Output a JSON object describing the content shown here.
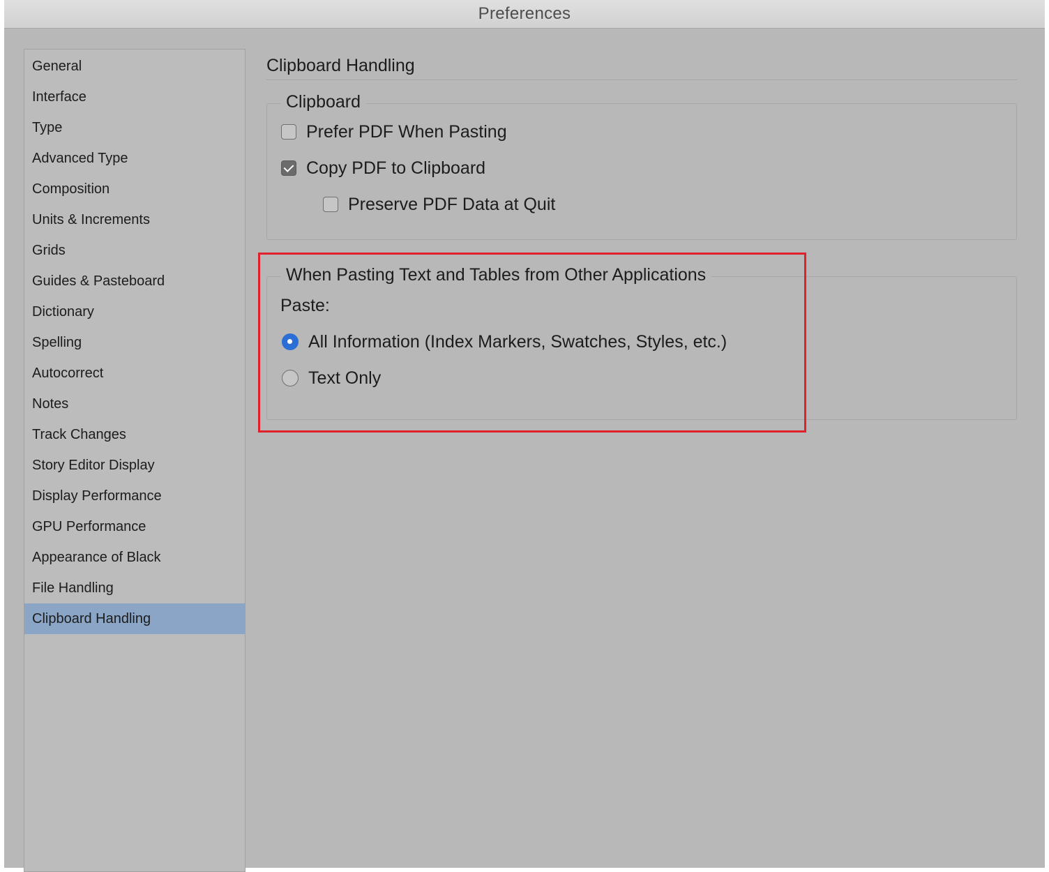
{
  "window": {
    "title": "Preferences"
  },
  "sidebar": {
    "items": [
      {
        "label": "General"
      },
      {
        "label": "Interface"
      },
      {
        "label": "Type"
      },
      {
        "label": "Advanced Type"
      },
      {
        "label": "Composition"
      },
      {
        "label": "Units & Increments"
      },
      {
        "label": "Grids"
      },
      {
        "label": "Guides & Pasteboard"
      },
      {
        "label": "Dictionary"
      },
      {
        "label": "Spelling"
      },
      {
        "label": "Autocorrect"
      },
      {
        "label": "Notes"
      },
      {
        "label": "Track Changes"
      },
      {
        "label": "Story Editor Display"
      },
      {
        "label": "Display Performance"
      },
      {
        "label": "GPU Performance"
      },
      {
        "label": "Appearance of Black"
      },
      {
        "label": "File Handling"
      },
      {
        "label": "Clipboard Handling"
      }
    ],
    "selected": "Clipboard Handling"
  },
  "main": {
    "title": "Clipboard Handling",
    "clipboard_group": {
      "legend": "Clipboard",
      "prefer_pdf": {
        "label": "Prefer PDF When Pasting",
        "checked": false
      },
      "copy_pdf": {
        "label": "Copy PDF to Clipboard",
        "checked": true
      },
      "preserve_pdf": {
        "label": "Preserve PDF Data at Quit",
        "checked": false
      }
    },
    "paste_group": {
      "legend": "When Pasting Text and Tables from Other Applications",
      "paste_label": "Paste:",
      "all_info": {
        "label": "All Information (Index Markers, Swatches, Styles, etc.)",
        "selected": true
      },
      "text_only": {
        "label": "Text Only",
        "selected": false
      }
    }
  },
  "colors": {
    "window_bg": "#b8b8b8",
    "selection": "#8aa5c6",
    "radio_accent": "#2a6ed6",
    "highlight": "#e0202a"
  }
}
